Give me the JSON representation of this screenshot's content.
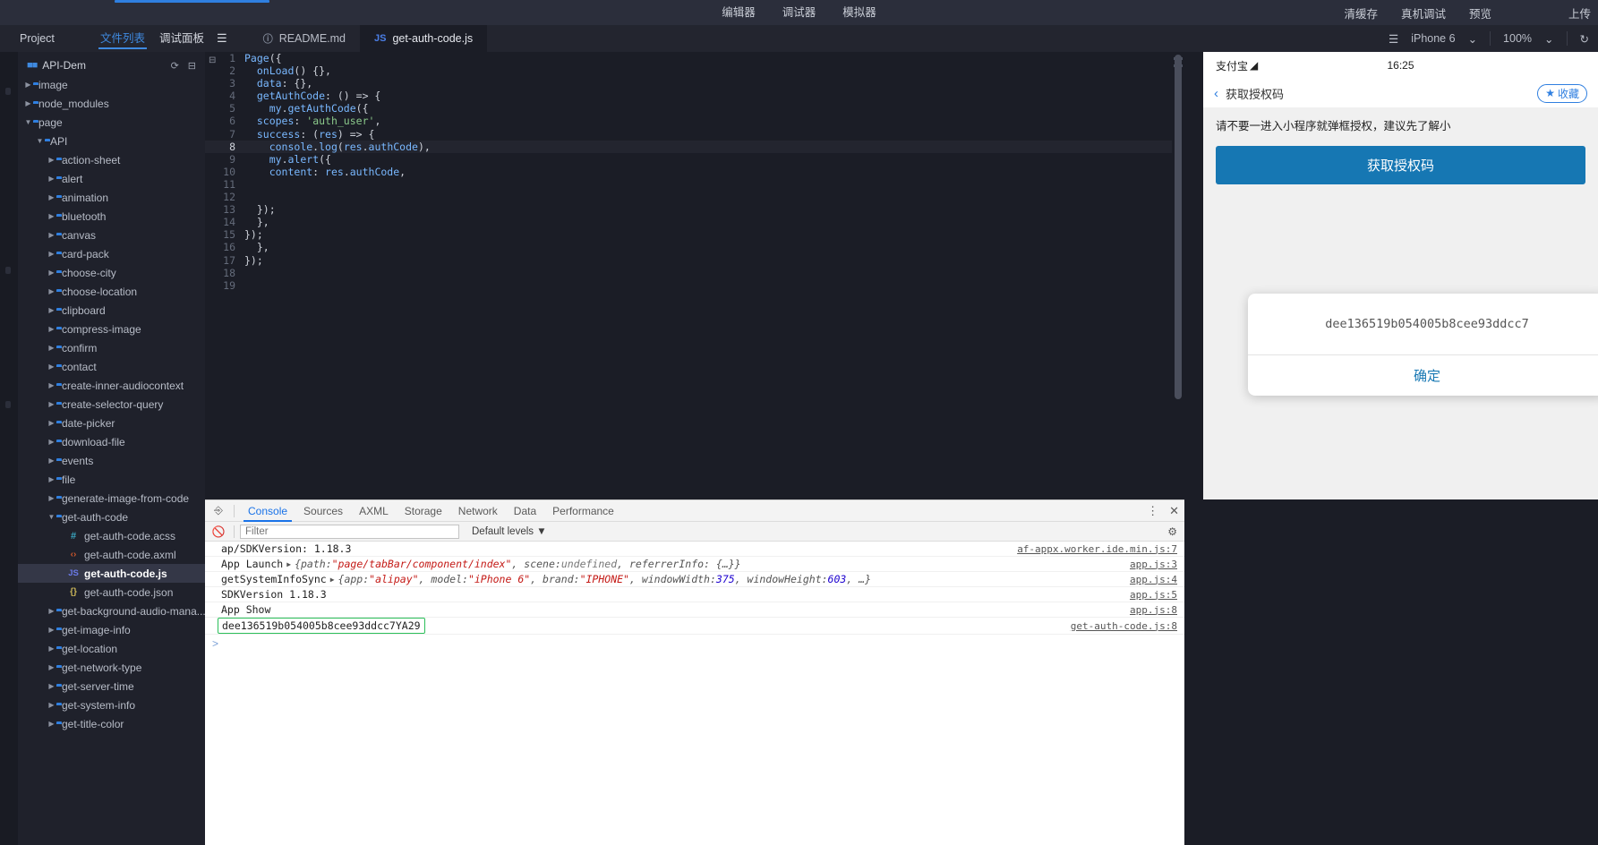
{
  "topbar": {
    "center_tabs": [
      {
        "label": "编辑器"
      },
      {
        "label": "调试器"
      },
      {
        "label": "模拟器"
      }
    ],
    "right_actions": [
      {
        "label": "清缓存"
      },
      {
        "label": "真机调试"
      },
      {
        "label": "预览"
      },
      {
        "label": "上传"
      }
    ]
  },
  "tabrow": {
    "project_label": "Project",
    "file_list_label": "文件列表",
    "debug_panel_label": "调试面板",
    "panel_toggle_icon": "panel-layout-icon",
    "editor_tabs": [
      {
        "label": "README.md",
        "icon": "info-icon",
        "active": false
      },
      {
        "label": "get-auth-code.js",
        "icon": "js-icon",
        "active": true
      }
    ],
    "right": {
      "layout_icon": "split-layout-icon",
      "device": "iPhone 6",
      "device_caret": "⌄",
      "zoom": "100%",
      "zoom_caret": "⌄",
      "refresh_icon": "refresh-icon"
    }
  },
  "sidebar": {
    "project_name": "API-Dem",
    "project_icon": "grid-icon",
    "actions": [
      {
        "name": "refresh-icon",
        "glyph": "⟳"
      },
      {
        "name": "collapse-icon",
        "glyph": "⊟"
      }
    ],
    "tree": [
      {
        "label": "image",
        "type": "folder",
        "depth": 0,
        "state": "collapsed"
      },
      {
        "label": "node_modules",
        "type": "folder",
        "depth": 0,
        "state": "collapsed"
      },
      {
        "label": "page",
        "type": "folder",
        "depth": 0,
        "state": "open"
      },
      {
        "label": "API",
        "type": "folder",
        "depth": 1,
        "state": "open"
      },
      {
        "label": "action-sheet",
        "type": "folder",
        "depth": 2,
        "state": "collapsed"
      },
      {
        "label": "alert",
        "type": "folder",
        "depth": 2,
        "state": "collapsed"
      },
      {
        "label": "animation",
        "type": "folder",
        "depth": 2,
        "state": "collapsed"
      },
      {
        "label": "bluetooth",
        "type": "folder",
        "depth": 2,
        "state": "collapsed"
      },
      {
        "label": "canvas",
        "type": "folder",
        "depth": 2,
        "state": "collapsed"
      },
      {
        "label": "card-pack",
        "type": "folder",
        "depth": 2,
        "state": "collapsed"
      },
      {
        "label": "choose-city",
        "type": "folder",
        "depth": 2,
        "state": "collapsed"
      },
      {
        "label": "choose-location",
        "type": "folder",
        "depth": 2,
        "state": "collapsed"
      },
      {
        "label": "clipboard",
        "type": "folder",
        "depth": 2,
        "state": "collapsed"
      },
      {
        "label": "compress-image",
        "type": "folder",
        "depth": 2,
        "state": "collapsed"
      },
      {
        "label": "confirm",
        "type": "folder",
        "depth": 2,
        "state": "collapsed"
      },
      {
        "label": "contact",
        "type": "folder",
        "depth": 2,
        "state": "collapsed"
      },
      {
        "label": "create-inner-audiocontext",
        "type": "folder",
        "depth": 2,
        "state": "collapsed"
      },
      {
        "label": "create-selector-query",
        "type": "folder",
        "depth": 2,
        "state": "collapsed"
      },
      {
        "label": "date-picker",
        "type": "folder",
        "depth": 2,
        "state": "collapsed"
      },
      {
        "label": "download-file",
        "type": "folder",
        "depth": 2,
        "state": "collapsed"
      },
      {
        "label": "events",
        "type": "folder",
        "depth": 2,
        "state": "collapsed"
      },
      {
        "label": "file",
        "type": "folder",
        "depth": 2,
        "state": "collapsed"
      },
      {
        "label": "generate-image-from-code",
        "type": "folder",
        "depth": 2,
        "state": "collapsed"
      },
      {
        "label": "get-auth-code",
        "type": "folder",
        "depth": 2,
        "state": "open"
      },
      {
        "label": "get-auth-code.acss",
        "type": "acss",
        "depth": 3,
        "state": "file"
      },
      {
        "label": "get-auth-code.axml",
        "type": "axml",
        "depth": 3,
        "state": "file"
      },
      {
        "label": "get-auth-code.js",
        "type": "js",
        "depth": 3,
        "state": "file",
        "selected": true
      },
      {
        "label": "get-auth-code.json",
        "type": "json",
        "depth": 3,
        "state": "file"
      },
      {
        "label": "get-background-audio-mana...",
        "type": "folder",
        "depth": 2,
        "state": "collapsed"
      },
      {
        "label": "get-image-info",
        "type": "folder",
        "depth": 2,
        "state": "collapsed"
      },
      {
        "label": "get-location",
        "type": "folder",
        "depth": 2,
        "state": "collapsed"
      },
      {
        "label": "get-network-type",
        "type": "folder",
        "depth": 2,
        "state": "collapsed"
      },
      {
        "label": "get-server-time",
        "type": "folder",
        "depth": 2,
        "state": "collapsed"
      },
      {
        "label": "get-system-info",
        "type": "folder",
        "depth": 2,
        "state": "collapsed"
      },
      {
        "label": "get-title-color",
        "type": "folder",
        "depth": 2,
        "state": "collapsed"
      }
    ]
  },
  "editor": {
    "lines": [
      {
        "n": "1",
        "text": "Page({"
      },
      {
        "n": "2",
        "text": "  onLoad() {},"
      },
      {
        "n": "3",
        "text": "  data: {},"
      },
      {
        "n": "4",
        "text": "  getAuthCode: () => {"
      },
      {
        "n": "5",
        "text": "    my.getAuthCode({"
      },
      {
        "n": "6",
        "text": "  scopes: 'auth_user',"
      },
      {
        "n": "7",
        "text": "  success: (res) => {"
      },
      {
        "n": "8",
        "text": "    console.log(res.authCode),",
        "highlight": true
      },
      {
        "n": "9",
        "text": "    my.alert({"
      },
      {
        "n": "10",
        "text": "    content: res.authCode,"
      },
      {
        "n": "11",
        "text": ""
      },
      {
        "n": "12",
        "text": ""
      },
      {
        "n": "13",
        "text": "  });"
      },
      {
        "n": "14",
        "text": "  },"
      },
      {
        "n": "15",
        "text": "});"
      },
      {
        "n": "16",
        "text": "  },"
      },
      {
        "n": "17",
        "text": "});"
      },
      {
        "n": "18",
        "text": ""
      },
      {
        "n": "19",
        "text": ""
      }
    ]
  },
  "simulator": {
    "status_bar": {
      "carrier": "支付宝",
      "wifi_icon": "wifi-icon",
      "time": "16:25"
    },
    "nav": {
      "back_icon": "chevron-left-icon",
      "title": "获取授权码",
      "fav_label": "收藏",
      "fav_icon": "star-icon"
    },
    "hint": "请不要一进入小程序就弹框授权，建议先了解小",
    "button_label": "获取授权码",
    "modal": {
      "content": "dee136519b054005b8cee93ddcc7",
      "ok_label": "确定"
    }
  },
  "devtools": {
    "cursor_icon": "inspect-cursor-icon",
    "tabs": [
      {
        "label": "Console",
        "active": true
      },
      {
        "label": "Sources",
        "active": false
      },
      {
        "label": "AXML",
        "active": false
      },
      {
        "label": "Storage",
        "active": false
      },
      {
        "label": "Network",
        "active": false
      },
      {
        "label": "Data",
        "active": false
      },
      {
        "label": "Performance",
        "active": false
      }
    ],
    "tabbar_right": [
      {
        "name": "more-options-icon",
        "glyph": "⋮"
      },
      {
        "name": "close-icon",
        "glyph": "✕"
      }
    ],
    "filterbar": {
      "clear_icon": "clear-console-icon",
      "filter_placeholder": "Filter",
      "filter_value": "",
      "levels_label": "Default levels",
      "levels_caret": "▼",
      "settings_icon": "gear-icon"
    },
    "logs": [
      {
        "parts": [
          {
            "t": "ap/SDKVersion: 1.18.3",
            "s": "plain"
          }
        ],
        "source": "af-appx.worker.ide.min.js:7"
      },
      {
        "parts": [
          {
            "t": "App Launch ",
            "s": "plain"
          },
          {
            "t": "▶",
            "s": "tri"
          },
          {
            "t": "{path: ",
            "s": "it"
          },
          {
            "t": "\"page/tabBar/component/index\"",
            "s": "red"
          },
          {
            "t": ", scene: ",
            "s": "it"
          },
          {
            "t": "undefined",
            "s": "gray"
          },
          {
            "t": ", referrerInfo: {…}}",
            "s": "it"
          }
        ],
        "source": "app.js:3"
      },
      {
        "parts": [
          {
            "t": "getSystemInfoSync ",
            "s": "plain"
          },
          {
            "t": "▶",
            "s": "tri"
          },
          {
            "t": "{app: ",
            "s": "it"
          },
          {
            "t": "\"alipay\"",
            "s": "red"
          },
          {
            "t": ", model: ",
            "s": "it"
          },
          {
            "t": "\"iPhone 6\"",
            "s": "red"
          },
          {
            "t": ", brand: ",
            "s": "it"
          },
          {
            "t": "\"IPHONE\"",
            "s": "red"
          },
          {
            "t": ", windowWidth: ",
            "s": "it"
          },
          {
            "t": "375",
            "s": "blue"
          },
          {
            "t": ", windowHeight: ",
            "s": "it"
          },
          {
            "t": "603",
            "s": "blue"
          },
          {
            "t": ", …}",
            "s": "it"
          }
        ],
        "source": "app.js:4"
      },
      {
        "parts": [
          {
            "t": "SDKVersion 1.18.3",
            "s": "plain"
          }
        ],
        "source": "app.js:5"
      },
      {
        "parts": [
          {
            "t": "App Show",
            "s": "plain"
          }
        ],
        "source": "app.js:8"
      },
      {
        "parts": [
          {
            "t": "dee136519b054005b8cee93ddcc7YA29",
            "s": "authbox"
          }
        ],
        "source": "get-auth-code.js:8"
      }
    ],
    "prompt": ">"
  }
}
